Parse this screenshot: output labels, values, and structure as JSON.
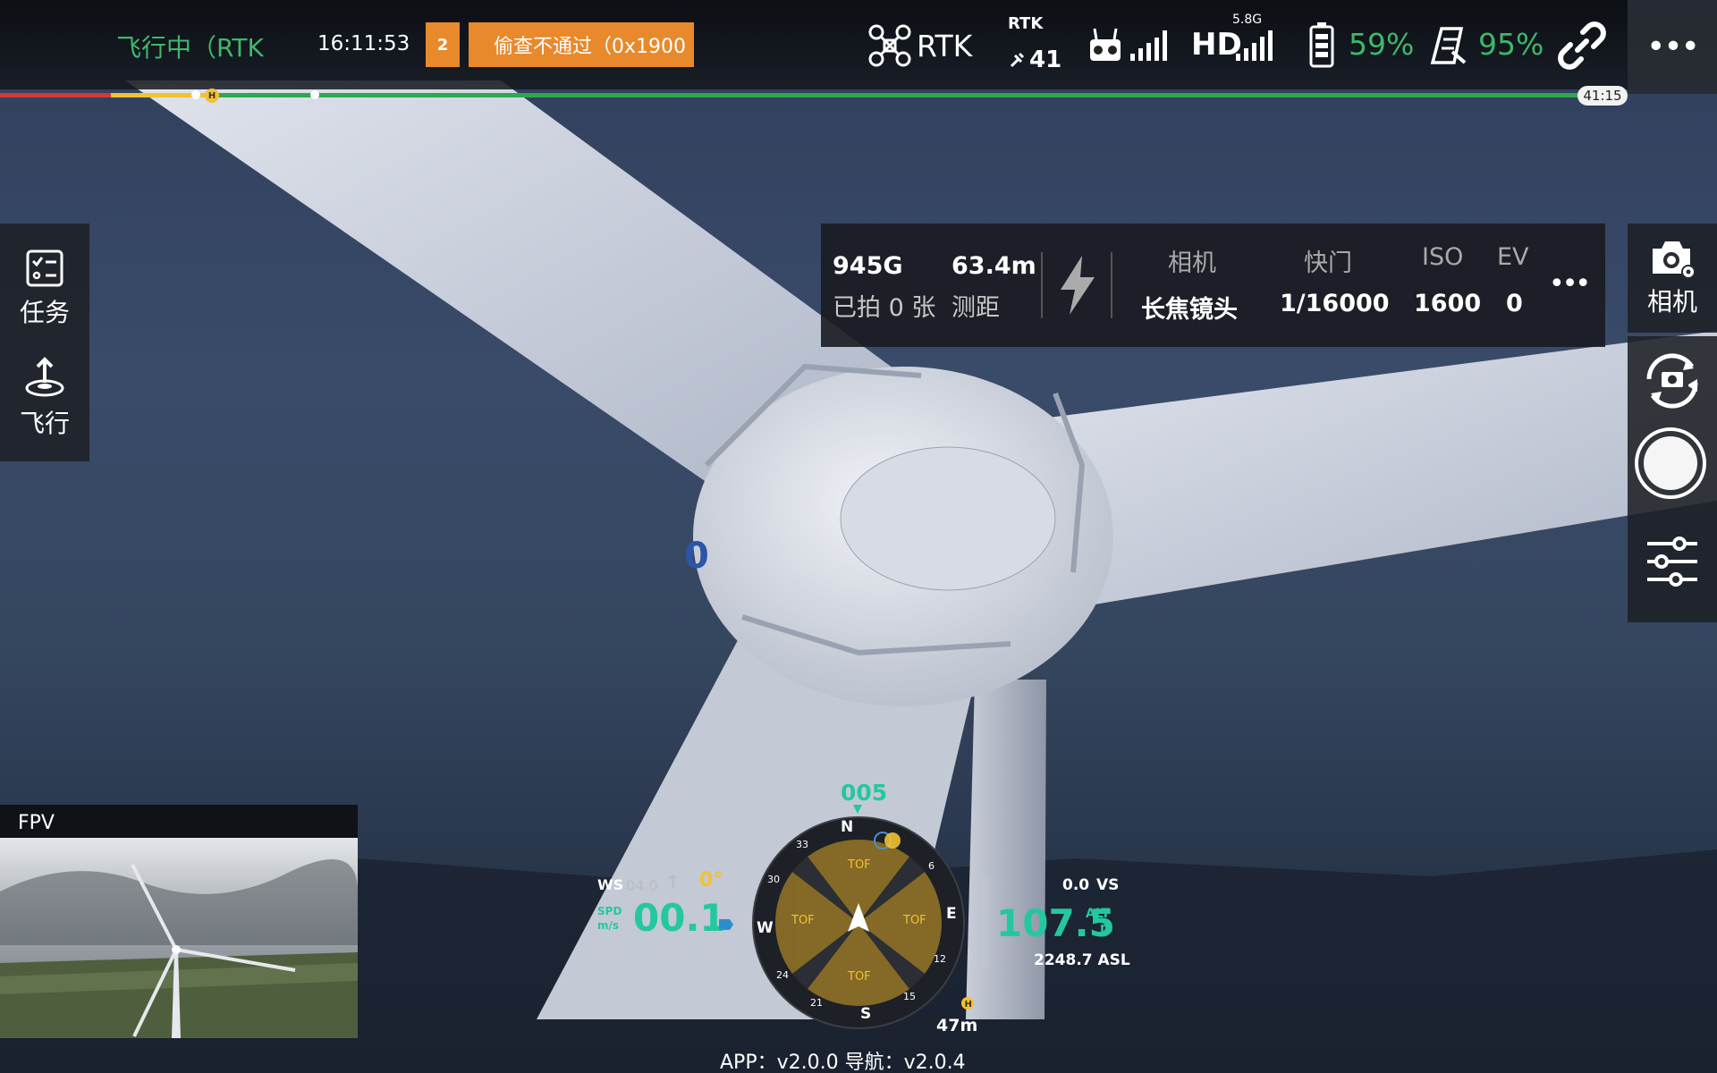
{
  "topbar": {
    "flight_status": "飞行中（RTK",
    "time": "16:11:53",
    "warning_count": "2",
    "warning_message": "偷查不通过（0x1900",
    "rtk_label": "RTK",
    "rtk_small_label": "RTK",
    "satellite_count": "41",
    "hd_label": "HD",
    "hd_band": "5.8G",
    "battery_percent": "59%",
    "rc_battery_percent": "95%",
    "more_label": "•••",
    "colors": {
      "green": "#3fb86a",
      "warning": "#e8892c",
      "link": "#ffffff"
    },
    "icons": [
      "aircraft-icon",
      "satellite-icon",
      "controller-icon",
      "signal-icon",
      "battery-icon",
      "rc-battery-icon",
      "link-icon",
      "more-icon"
    ]
  },
  "progress": {
    "flight_time": "41:15",
    "home_marker": "H"
  },
  "left_panel": {
    "items": [
      {
        "label": "任务",
        "icon": "checklist-icon"
      },
      {
        "label": "飞行",
        "icon": "takeoff-icon"
      }
    ]
  },
  "camera_panel": {
    "storage": "945G",
    "photos_taken": "已拍 0 张",
    "distance": "63.4m",
    "distance_label": "测距",
    "camera_header": "相机",
    "camera_value": "长焦镜头",
    "shutter_header": "快门",
    "shutter_value": "1/16000",
    "iso_header": "ISO",
    "iso_value": "1600",
    "ev_header": "EV",
    "ev_value": "0",
    "more_label": "•••",
    "icons": [
      "flash-icon"
    ]
  },
  "right_panel": {
    "camera_label": "相机",
    "icons": [
      "camera-settings-icon",
      "camera-switch-icon",
      "shutter-icon",
      "settings-sliders-icon"
    ]
  },
  "fpv": {
    "label": "FPV"
  },
  "hud": {
    "heading": "005",
    "ws_label": "WS",
    "wind_speed": "04.0",
    "wind_arrow": "↑",
    "gimbal_angle": "0°",
    "speed_unit_top": "SPD",
    "speed_unit_bottom": "m/s",
    "speed": "00.1",
    "vs_value": "0.0",
    "vs_label": "VS",
    "altitude": "107.5",
    "alt_label": "ALT",
    "alt_unit": "m",
    "asl": "2248.7 ASL",
    "home_distance": "47m",
    "compass": {
      "n": "N",
      "e": "E",
      "s": "S",
      "w": "W",
      "ticks": [
        "33",
        "30",
        "24",
        "21",
        "15",
        "12",
        "6"
      ],
      "tof_labels": [
        "TOF",
        "TOF",
        "TOF",
        "TOF"
      ]
    }
  },
  "footer": {
    "version": "APP：v2.0.0    导航：v2.0.4"
  }
}
